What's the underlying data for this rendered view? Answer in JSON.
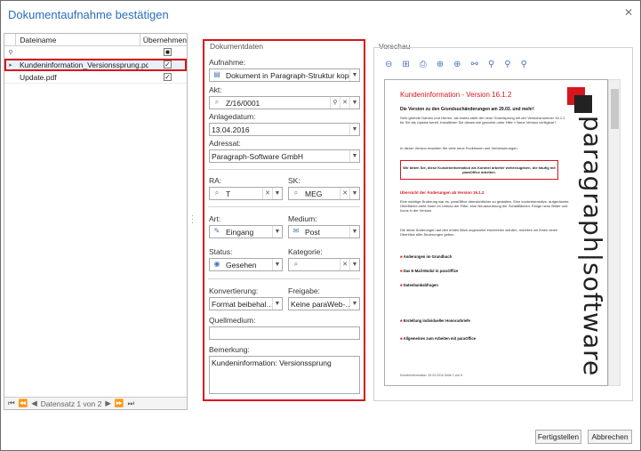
{
  "window": {
    "title": "Dokumentaufnahme bestätigen",
    "close": "✕"
  },
  "grid": {
    "col_name": "Dateiname",
    "col_taken": "Übernehmen",
    "rows": [
      {
        "name": "Kundeninformation_Versionssprung.pdf",
        "checked": true,
        "selected": true
      },
      {
        "name": "Update.pdf",
        "checked": true,
        "selected": false
      }
    ],
    "nav_label": "Datensatz 1 von 2"
  },
  "form": {
    "legend": "Dokumentdaten",
    "aufnahme_label": "Aufnahme:",
    "aufnahme_value": "Dokument in Paragraph-Struktur kopie…",
    "akt_label": "Akt:",
    "akt_value": "Z/16/0001",
    "anlagedatum_label": "Anlagedatum:",
    "anlagedatum_value": "13.04.2016",
    "adressat_label": "Adressat:",
    "adressat_value": "Paragraph-Software GmbH",
    "ra_label": "RA:",
    "ra_value": "T",
    "sk_label": "SK:",
    "sk_value": "MEG",
    "art_label": "Art:",
    "art_value": "Eingang",
    "medium_label": "Medium:",
    "medium_value": "Post",
    "status_label": "Status:",
    "status_value": "Gesehen",
    "kategorie_label": "Kategorie:",
    "kategorie_value": "",
    "konvertierung_label": "Konvertierung:",
    "konvertierung_value": "Format beibehal…",
    "freigabe_label": "Freigabe:",
    "freigabe_value": "Keine paraWeb-…",
    "quellmedium_label": "Quellmedium:",
    "quellmedium_value": "",
    "bemerkung_label": "Bemerkung:",
    "bemerkung_value": "Kundeninformation: Versionssprung"
  },
  "preview": {
    "label": "Vorschau",
    "doc_title": "Kundeninformation - Version 16.1.2",
    "doc_subtitle": "Die Version zu den Grundsuchänderungen am 29.03. und mehr!",
    "doc_p1": "Sehr geehrte Damen und Herren, als erstes steht der neue Grundsprung mit der Versionsnummer 16.1.2 für Sie als Update bereit. Installieren Sie dieses wie gewohnt unter Hilfe » Neue Version verfügbar?",
    "doc_p2": "In dieser Version erwarten Sie viele neue Funktionen und Verbesserungen.",
    "doc_box": "Wir bitten Sie, diese Kundeninformation als Kontext arbeiter weiterzugeben, die häufig mit paraOffice arbeiten.",
    "doc_sec": "Übersicht der Änderungen ab Version 16.1.2",
    "doc_p3": "Eine wichtige Änderung war es, paraOffice übersichtlicher zu gestalten. Eine kontextsensitive, aufgeräumte Oberfläche steht Ihnen im Umbau der Filter, eine Neuanordnung der Schaltflächen. Einige neue Bilder und Icons in der Version.",
    "doc_p4": "Die diese Änderungen auf den ersten Blick ungewohnt erscheinen werden, möchten wir Ihnen einen Überblick aller Änderungen geben.",
    "items": [
      "Änderungen im Grundbuch",
      "Das E-Mail-Modul in paraOffice",
      "Datenbankabfragen",
      "Erstellung individueller Honorarbriefe",
      "Allgemeines zum Arbeiten mit paraOffice"
    ],
    "logo_text": "paragraph|software",
    "footer": "Kundeninformation: 29.03.2016 Seite 1 von 5"
  },
  "buttons": {
    "finish": "Fertigstellen",
    "cancel": "Abbrechen"
  },
  "colors": {
    "accent": "#d7161e",
    "title": "#2a6ebb"
  }
}
